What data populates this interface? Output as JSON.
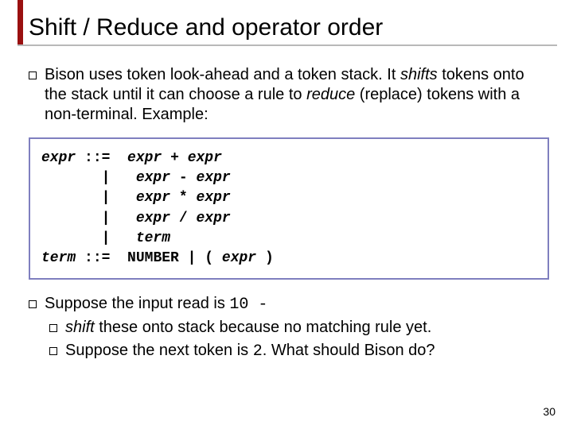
{
  "title": "Shift / Reduce and operator order",
  "para1_pre": "Bison uses token look-ahead and a token stack.  It ",
  "para1_shifts": "shifts",
  "para1_mid": " tokens onto the stack until it can choose a rule to ",
  "para1_reduce": "reduce",
  "para1_post": " (replace) tokens with a non-terminal. Example:",
  "grammar": [
    {
      "lhs": "expr",
      "op": "::=",
      "rhs": "expr + expr"
    },
    {
      "lhs": "",
      "op": " | ",
      "rhs": "expr - expr"
    },
    {
      "lhs": "",
      "op": " | ",
      "rhs": "expr * expr"
    },
    {
      "lhs": "",
      "op": " | ",
      "rhs": "expr / expr"
    },
    {
      "lhs": "",
      "op": " | ",
      "rhs": "term"
    },
    {
      "lhs": "term",
      "op": "::=",
      "rhs": "NUMBER | ( expr )"
    }
  ],
  "bullet2_pre": "Suppose the input read is ",
  "bullet2_code": "10 -",
  "bullet3_shift": "shift",
  "bullet3_rest": " these onto stack because no matching rule yet.",
  "bullet4_pre": "Suppose the next token is ",
  "bullet4_code": "2",
  "bullet4_post": ".  What should Bison do?",
  "page_number": "30"
}
